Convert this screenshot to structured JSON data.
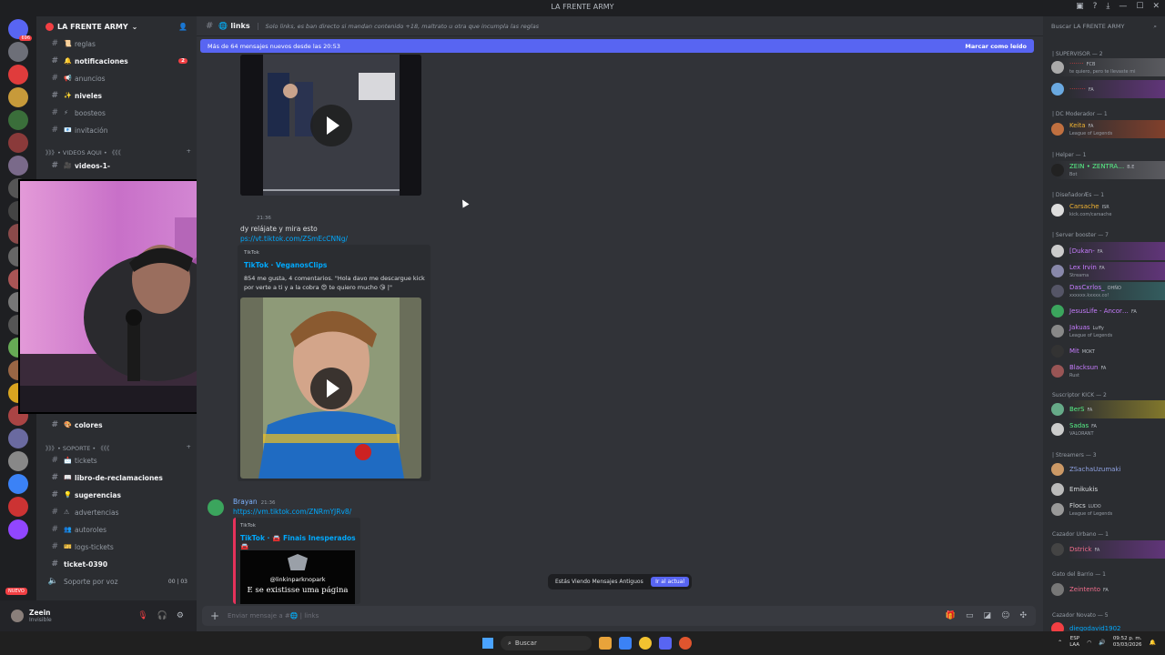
{
  "window": {
    "title": "LA FRENTE ARMY"
  },
  "server_badge_top": "696",
  "server_badge_mid": "184",
  "nuevo_label": "NUEVO",
  "guild": {
    "name": "LA FRENTE ARMY"
  },
  "channels": [
    {
      "name": "reglas",
      "emoji": "📜",
      "bright": false
    },
    {
      "name": "notificaciones",
      "emoji": "🔔",
      "bright": true,
      "mention": "2"
    },
    {
      "name": "anuncios",
      "emoji": "📢",
      "bright": false
    },
    {
      "name": "niveles",
      "emoji": "✨",
      "bright": true
    },
    {
      "name": "boosteos",
      "emoji": "⚡",
      "bright": false
    },
    {
      "name": "invitación",
      "emoji": "📧",
      "bright": false
    },
    {
      "name": "videos-1-",
      "emoji": "🎥",
      "bright": true
    }
  ],
  "category_videos": "》》》• VIDEOS AQUI • 《《《",
  "channels_lower": [
    {
      "name": "colores",
      "emoji": "🎨",
      "bright": true
    }
  ],
  "category_soporte": "》》》• SOPORTE • 《《《",
  "channels_soporte": [
    {
      "name": "tickets",
      "emoji": "📩",
      "bright": false
    },
    {
      "name": "libro-de-reclamaciones",
      "emoji": "📖",
      "bright": true
    },
    {
      "name": "sugerencias",
      "emoji": "💡",
      "bright": true
    },
    {
      "name": "advertencias",
      "emoji": "⚠",
      "bright": false
    },
    {
      "name": "autoroles",
      "emoji": "👥",
      "bright": false
    },
    {
      "name": "logs-tickets",
      "emoji": "🎫",
      "bright": false
    },
    {
      "name": "ticket-0390",
      "emoji": "",
      "bright": true
    }
  ],
  "voice_channel": {
    "name": "Soporte por voz",
    "count": "00 | 03"
  },
  "user": {
    "name": "Zeein",
    "status": "Invisible"
  },
  "header": {
    "channel": "links",
    "topic": "Solo links, es ban directo si mandan contenido +18, maltrato u otra que incumpla las reglas"
  },
  "new_messages": {
    "text": "Más de 64 mensajes nuevos desde las 20:53",
    "mark": "Marcar como leído"
  },
  "messages": {
    "m1_time": "21:36",
    "m1_text": "dy relájate y mira esto",
    "m1_link": "ps://vt.tiktok.com/ZSmEcCNNg/",
    "embed1": {
      "provider": "TikTok",
      "title": "TikTok · VeganosClips",
      "desc": "854 me gusta, 4 comentarios. \"Hola davo me descargue kick por verte a ti y a la cobra 😍 te quiero mucho 😘 |\""
    },
    "m2_author": "Brayan",
    "m2_time": "21:36",
    "m2_link": "https://vm.tiktok.com/ZNRmYJRv8/",
    "embed2": {
      "provider": "TikTok",
      "title": "TikTok · 🚘 Finais Inesperados 🚘",
      "caption_handle": "@linkinparknopark",
      "caption_text": "E se existisse uma página"
    }
  },
  "old_messages_bar": {
    "text": "Estás Viendo Mensajes Antiguos",
    "button": "Ir al actual"
  },
  "composer": {
    "placeholder": "Enviar mensaje a #🌐 | links"
  },
  "member_search": {
    "placeholder": "Buscar LA FRENTE ARMY"
  },
  "roles": [
    {
      "label": "| SUPERVISOR — 2"
    },
    {
      "label": "| DC Moderador — 1"
    },
    {
      "label": "| Helper — 1"
    },
    {
      "label": "| DiseñadorÆs — 1"
    },
    {
      "label": "| Server booster — 7"
    },
    {
      "label": "Suscriptor KICK — 2"
    },
    {
      "label": "| Streamers — 3"
    },
    {
      "label": "Cazador Urbano — 1"
    },
    {
      "label": "Gato del Barrio — 1"
    },
    {
      "label": "Cazador Novato — 5"
    }
  ],
  "members": [
    {
      "name": "·······",
      "sub": "te quiero, pero te llevaste mi",
      "tag": "FCB",
      "color": "#e03c3c",
      "av": "#aaa",
      "style": "gray"
    },
    {
      "name": "········",
      "sub": "",
      "tag": "FA",
      "color": "#e03c3c",
      "av": "#6aa9e0",
      "style": "purple"
    },
    {
      "name": "Keita",
      "sub": "League of Legends",
      "tag": "FA",
      "color": "#f0b232",
      "av": "#c07040",
      "style": "orange"
    },
    {
      "name": "ZEIN • ZENTRA…",
      "sub": "Bot",
      "tag": "B.E",
      "color": "#57f287",
      "av": "#222",
      "style": "gray"
    },
    {
      "name": "Carsache",
      "sub": "kick.com/carsache",
      "tag": "ISR",
      "color": "#f0b232",
      "av": "#ddd",
      "style": ""
    },
    {
      "name": "[Dukan-",
      "sub": "",
      "tag": "FA",
      "color": "#c77dff",
      "av": "#ccc",
      "style": "purple"
    },
    {
      "name": "Lex Irvin",
      "sub": "Streama",
      "tag": "FA",
      "color": "#c77dff",
      "av": "#88a",
      "style": "purple"
    },
    {
      "name": "DasCxrlos_",
      "sub": "xxxxxx.kxxxx.co!",
      "tag": "OHÑO",
      "color": "#c77dff",
      "av": "#556",
      "style": "teal"
    },
    {
      "name": "JesusLife - Ancor…",
      "sub": "",
      "tag": "FA",
      "color": "#c77dff",
      "av": "#3ba55d",
      "style": ""
    },
    {
      "name": "Jakuas",
      "sub": "League of Legends",
      "tag": "Luffy",
      "color": "#c77dff",
      "av": "#888",
      "style": ""
    },
    {
      "name": "Mit",
      "sub": "",
      "tag": "MOKT",
      "color": "#c77dff",
      "av": "#333",
      "style": ""
    },
    {
      "name": "Blacksun",
      "sub": "Rust",
      "tag": "FA",
      "color": "#c77dff",
      "av": "#955",
      "style": ""
    },
    {
      "name": "BerS",
      "sub": "",
      "tag": "FA",
      "color": "#57f287",
      "av": "#6a8",
      "style": "yellow"
    },
    {
      "name": "Sadas",
      "sub": "VALORANT",
      "tag": "FA",
      "color": "#57f287",
      "av": "#ccc",
      "style": ""
    },
    {
      "name": "ZSachaUzumaki",
      "sub": "",
      "tag": "",
      "color": "#8ea1e1",
      "av": "#c96",
      "style": ""
    },
    {
      "name": "Emikukis",
      "sub": "",
      "tag": "",
      "color": "#dbdee1",
      "av": "#bbb",
      "style": ""
    },
    {
      "name": "Flocs",
      "sub": "League of Legends",
      "tag": "LUDO",
      "color": "#dbdee1",
      "av": "#999",
      "style": ""
    },
    {
      "name": "Dstrick",
      "sub": "",
      "tag": "FA",
      "color": "#f26e8d",
      "av": "#444",
      "style": "purple"
    },
    {
      "name": "Zeintento",
      "sub": "",
      "tag": "FA",
      "color": "#f26e8d",
      "av": "#777",
      "style": ""
    },
    {
      "name": "diegodavid1902",
      "sub": "",
      "tag": "",
      "color": "#00a8fc",
      "av": "#f23f43",
      "style": ""
    }
  ],
  "taskbar": {
    "search": "Buscar",
    "lang1": "ESP",
    "lang2": "LAA",
    "time": "09:52 p. m.",
    "date": "03/03/2026"
  }
}
